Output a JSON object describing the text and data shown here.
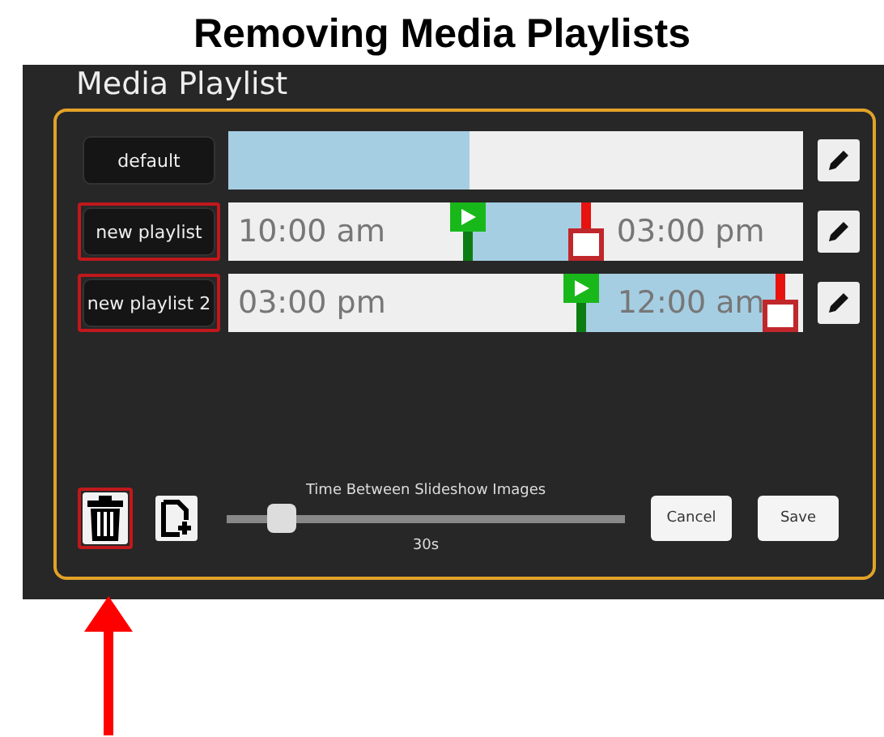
{
  "heading": "Removing Media Playlists",
  "window": {
    "title": "Media Playlist"
  },
  "playlists": [
    {
      "name": "default",
      "highlighted": false,
      "timeline": {
        "level": 0.42
      }
    },
    {
      "name": "new playlist",
      "highlighted": true,
      "timeline": {
        "start_time": "10:00 am",
        "end_time": "03:00 pm",
        "handles": [
          {
            "kind": "start",
            "level": 0.41
          },
          {
            "kind": "end",
            "level": 0.63
          }
        ]
      }
    },
    {
      "name": "new playlist 2",
      "highlighted": true,
      "timeline": {
        "start_time": "03:00 pm",
        "end_time": "12:00 am",
        "handles": [
          {
            "kind": "start",
            "level": 0.62
          },
          {
            "kind": "end",
            "level": 0.99
          }
        ]
      }
    }
  ],
  "delete_button": {
    "highlighted": true
  },
  "slider": {
    "label": "Time Between Slideshow Images",
    "level": 0.11,
    "reading": "30s"
  },
  "buttons": [
    "Cancel",
    "Save"
  ],
  "annotation": {
    "arrow": true
  }
}
